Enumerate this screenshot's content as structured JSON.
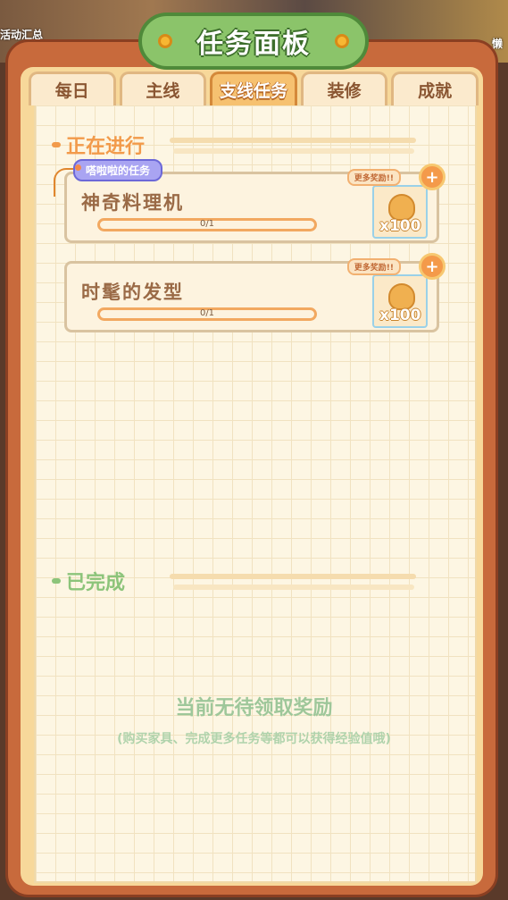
{
  "background": {
    "left_label": "活动汇总",
    "right_label": "懒"
  },
  "title": "任务面板",
  "tabs": [
    {
      "label": "每日",
      "active": false
    },
    {
      "label": "主线",
      "active": false
    },
    {
      "label": "支线任务",
      "active": true
    },
    {
      "label": "装修",
      "active": false
    },
    {
      "label": "成就",
      "active": false
    }
  ],
  "in_progress": {
    "heading": "正在进行",
    "tag": "嗒啦啦的任务",
    "tasks": [
      {
        "title": "神奇料理机",
        "progress_text": "0/1",
        "progress": 0,
        "reward_qty": "x100",
        "more_rewards": "更多奖励!!",
        "reward_icon": "gold-statue-icon"
      },
      {
        "title": "时髦的发型",
        "progress_text": "0/1",
        "progress": 0,
        "reward_qty": "x100",
        "more_rewards": "更多奖励!!",
        "reward_icon": "gold-statue-icon"
      }
    ]
  },
  "completed": {
    "heading": "已完成",
    "empty_title": "当前无待领取奖励",
    "empty_subtitle": "(购买家具、完成更多任务等都可以获得经验值哦)"
  },
  "colors": {
    "accent_green": "#8bc46a",
    "progress_orange": "#f2a860",
    "frame": "#c86a3c"
  }
}
